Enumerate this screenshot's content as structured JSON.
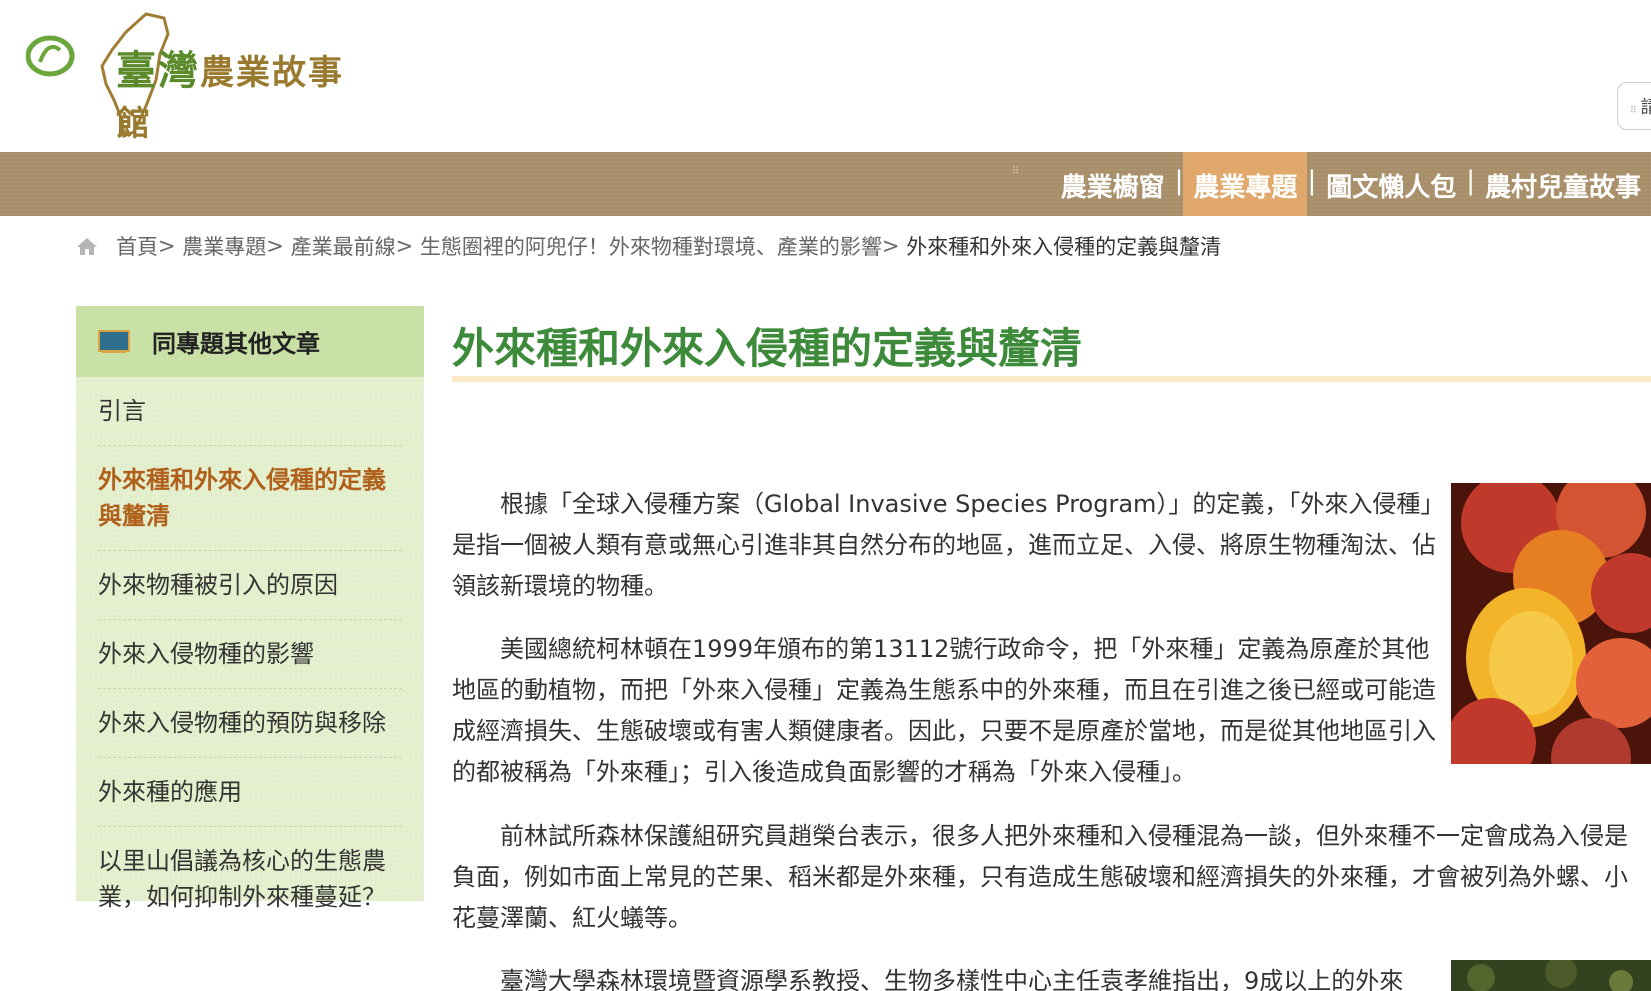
{
  "header": {
    "logo_main": "臺灣",
    "logo_sub": "農業故事館",
    "side_tab": "請"
  },
  "nav": {
    "items": [
      {
        "label": "農業櫥窗",
        "active": false
      },
      {
        "label": "農業專題",
        "active": true
      },
      {
        "label": "圖文懶人包",
        "active": false
      },
      {
        "label": "農村兒童故事",
        "active": false
      }
    ],
    "separator": "|"
  },
  "breadcrumb": {
    "items": [
      "首頁",
      "農業專題",
      "產業最前線",
      "生態圈裡的阿兜仔！外來物種對環境、產業的影響"
    ],
    "separator": ">",
    "current": "外來種和外來入侵種的定義與釐清"
  },
  "sidebar": {
    "title": "同專題其他文章",
    "items": [
      {
        "label": "引言",
        "active": false
      },
      {
        "label": "外來種和外來入侵種的定義與釐清",
        "active": true
      },
      {
        "label": "外來物種被引入的原因",
        "active": false
      },
      {
        "label": "外來入侵物種的影響",
        "active": false
      },
      {
        "label": "外來入侵物種的預防與移除",
        "active": false
      },
      {
        "label": "外來種的應用",
        "active": false
      },
      {
        "label": "以里山倡議為核心的生態農業，如何抑制外來種蔓延？",
        "active": false
      }
    ]
  },
  "article": {
    "title": "外來種和外來入侵種的定義與釐清",
    "paragraphs": [
      "根據「全球入侵種方案（Global Invasive Species Program）」的定義，「外來入侵種」是指一個被人類有意或無心引進非其自然分布的地區，進而立足、入侵、將原生物種淘汰、佔領該新環境的物種。",
      "美國總統柯林頓在1999年頒布的第13112號行政命令，把「外來種」定義為原產於其他地區的動植物，而把「外來入侵種」定義為生態系中的外來種，而且在引進之後已經或可能造成經濟損失、生態破壞或有害人類健康者。因此，只要不是原產於當地，而是從其他地區引入的都被稱為「外來種」；引入後造成負面影響的才稱為「外來入侵種」。",
      "前林試所森林保護組研究員趙榮台表示，很多人把外來種和入侵種混為一談，但外來種不一定會成為入侵是負面，例如市面上常見的芒果、稻米都是外來種，只有造成生態破壞和經濟損失的外來種，才會被列為外螺、小花蔓澤蘭、紅火蟻等。",
      "臺灣大學森林環境暨資源學系教授、生物多樣性中心主任袁孝維指出，9成以上的外來"
    ]
  },
  "colors": {
    "nav_bg": "#a88f6a",
    "nav_active": "#e0a86b",
    "title_green": "#3d8a3a",
    "sidebar_bg": "#e3efcc",
    "sidebar_active": "#b0601a"
  },
  "icons": {
    "home": "home-icon",
    "sidebar": "chalkboard-icon"
  }
}
